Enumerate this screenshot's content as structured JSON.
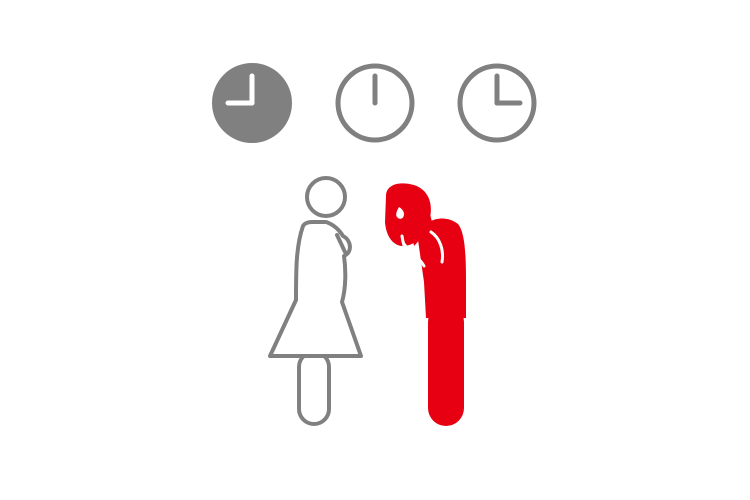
{
  "colors": {
    "background": "#ffffff",
    "gray": "#808080",
    "red": "#e60012",
    "white": "#ffffff"
  },
  "icons": {
    "clock_1": "clock-filled-icon",
    "clock_2": "clock-outline-icon",
    "clock_3": "clock-outline-icon",
    "woman": "woman-figure-icon",
    "man": "bowing-man-crying-icon"
  },
  "clocks": [
    {
      "style": "filled",
      "time": "9:00"
    },
    {
      "style": "outline",
      "time": "12:00"
    },
    {
      "style": "outline",
      "time": "3:00"
    }
  ]
}
